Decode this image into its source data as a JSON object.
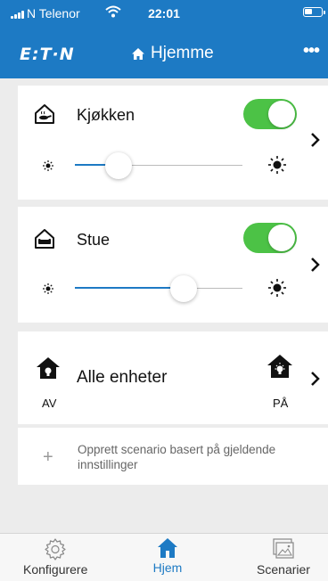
{
  "status_bar": {
    "carrier": "N Telenor",
    "time": "22:01"
  },
  "header": {
    "logo": "E:T·N",
    "title": "Hjemme"
  },
  "rooms": [
    {
      "name": "Kjøkken",
      "on": true,
      "brightness": 0.26
    },
    {
      "name": "Stue",
      "on": true,
      "brightness": 0.65
    }
  ],
  "all_devices": {
    "label": "Alle enheter",
    "off_label": "AV",
    "on_label": "PÅ"
  },
  "create_scenario": {
    "text": "Opprett scenario basert på gjeldende innstillinger"
  },
  "tabs": [
    {
      "label": "Konfigurere",
      "active": false
    },
    {
      "label": "Hjem",
      "active": true
    },
    {
      "label": "Scenarier",
      "active": false
    }
  ],
  "colors": {
    "brand": "#1d7ac4",
    "toggle_on": "#4cc246"
  }
}
